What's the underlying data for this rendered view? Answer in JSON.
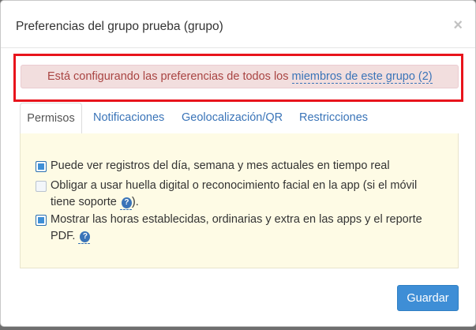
{
  "modal": {
    "title": "Preferencias del grupo prueba (grupo)",
    "close_symbol": "×"
  },
  "alert": {
    "text": "Está configurando las preferencias de todos los ",
    "link_text": "miembros de este grupo (2)",
    "color": "#a94442",
    "background": "#f2dede"
  },
  "tabs": [
    {
      "label": "Permisos",
      "active": true
    },
    {
      "label": "Notificaciones",
      "active": false
    },
    {
      "label": "Geolocalización/QR",
      "active": false
    },
    {
      "label": "Restricciones",
      "active": false
    }
  ],
  "permissions": [
    {
      "label": "Puede ver registros del día, semana y mes actuales en tiempo real",
      "checked": true
    },
    {
      "label": "Obligar a usar huella digital o reconocimiento facial en la app (si el móvil tiene soporte ",
      "suffix": ").",
      "checked": false,
      "help_icon": "question-circle-icon"
    },
    {
      "label": "Mostrar las horas establecidas, ordinarias y extra en las apps y el reporte PDF. ",
      "checked": true,
      "help_icon": "question-circle-icon"
    }
  ],
  "help_glyph": "?",
  "footer": {
    "save_label": "Guardar"
  },
  "colors": {
    "accent": "#3e8ed6",
    "link": "#3a74b8",
    "panel_bg": "#fefbe5",
    "highlight_border": "#e8141c"
  }
}
